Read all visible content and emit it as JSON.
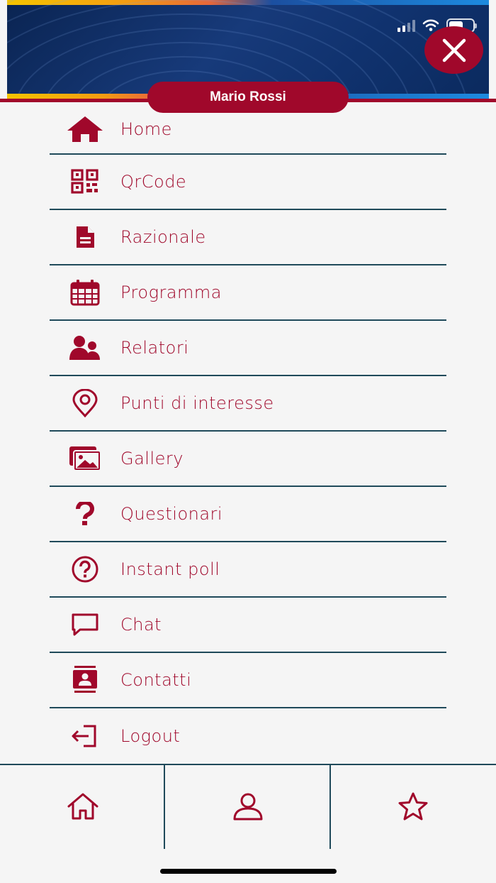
{
  "user": {
    "name": "Mario Rossi"
  },
  "colors": {
    "accent": "#a0082b",
    "divider": "#1f4a5a",
    "header": "#10326e"
  },
  "header": {
    "close_icon": "close-icon"
  },
  "menu": {
    "items": [
      {
        "label": "Home",
        "icon": "home-icon"
      },
      {
        "label": "QrCode",
        "icon": "qrcode-icon"
      },
      {
        "label": "Razionale",
        "icon": "document-icon"
      },
      {
        "label": "Programma",
        "icon": "calendar-icon"
      },
      {
        "label": "Relatori",
        "icon": "speakers-icon"
      },
      {
        "label": "Punti di interesse",
        "icon": "location-pin-icon"
      },
      {
        "label": "Gallery",
        "icon": "gallery-icon"
      },
      {
        "label": "Questionari",
        "icon": "question-mark-icon"
      },
      {
        "label": "Instant poll",
        "icon": "question-circle-icon"
      },
      {
        "label": "Chat",
        "icon": "chat-icon"
      },
      {
        "label": "Contatti",
        "icon": "contacts-icon"
      },
      {
        "label": "Logout",
        "icon": "logout-icon"
      }
    ]
  },
  "tabbar": {
    "tabs": [
      {
        "icon": "home-outline-icon"
      },
      {
        "icon": "profile-icon"
      },
      {
        "icon": "star-icon"
      }
    ]
  }
}
